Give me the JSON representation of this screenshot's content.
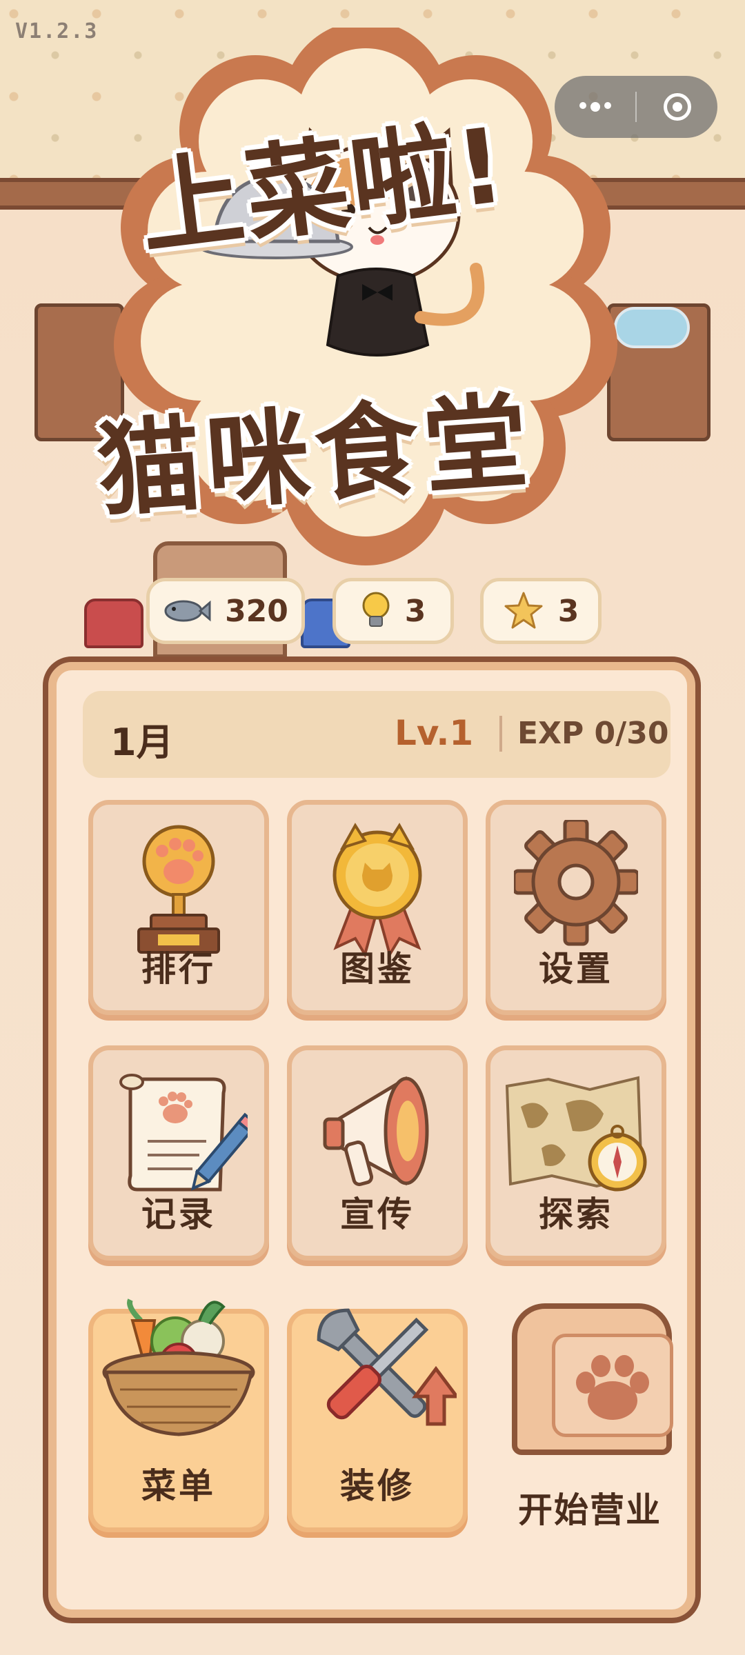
{
  "app": {
    "version": "V1.2.3"
  },
  "logo": {
    "title_line1": "上菜啦!",
    "title_line2": "猫咪食堂"
  },
  "resources": [
    {
      "icon": "fish-icon",
      "value": "320"
    },
    {
      "icon": "lightbulb-icon",
      "value": "3"
    },
    {
      "icon": "star-icon",
      "value": "3"
    }
  ],
  "status": {
    "month": "1月",
    "level": "Lv.1",
    "exp": "EXP 0/30"
  },
  "menu": [
    {
      "label": "排行",
      "icon": "trophy-icon"
    },
    {
      "label": "图鉴",
      "icon": "medal-icon"
    },
    {
      "label": "设置",
      "icon": "gear-icon"
    },
    {
      "label": "记录",
      "icon": "scroll-icon"
    },
    {
      "label": "宣传",
      "icon": "megaphone-icon"
    },
    {
      "label": "探索",
      "icon": "map-icon"
    },
    {
      "label": "菜单",
      "icon": "basket-icon"
    },
    {
      "label": "装修",
      "icon": "tools-icon"
    },
    {
      "label": "开始营业",
      "icon": "paw-sign-icon"
    }
  ],
  "colors": {
    "accent": "#b5612e",
    "text": "#4a2d1c",
    "panel_border": "#8a5237"
  }
}
